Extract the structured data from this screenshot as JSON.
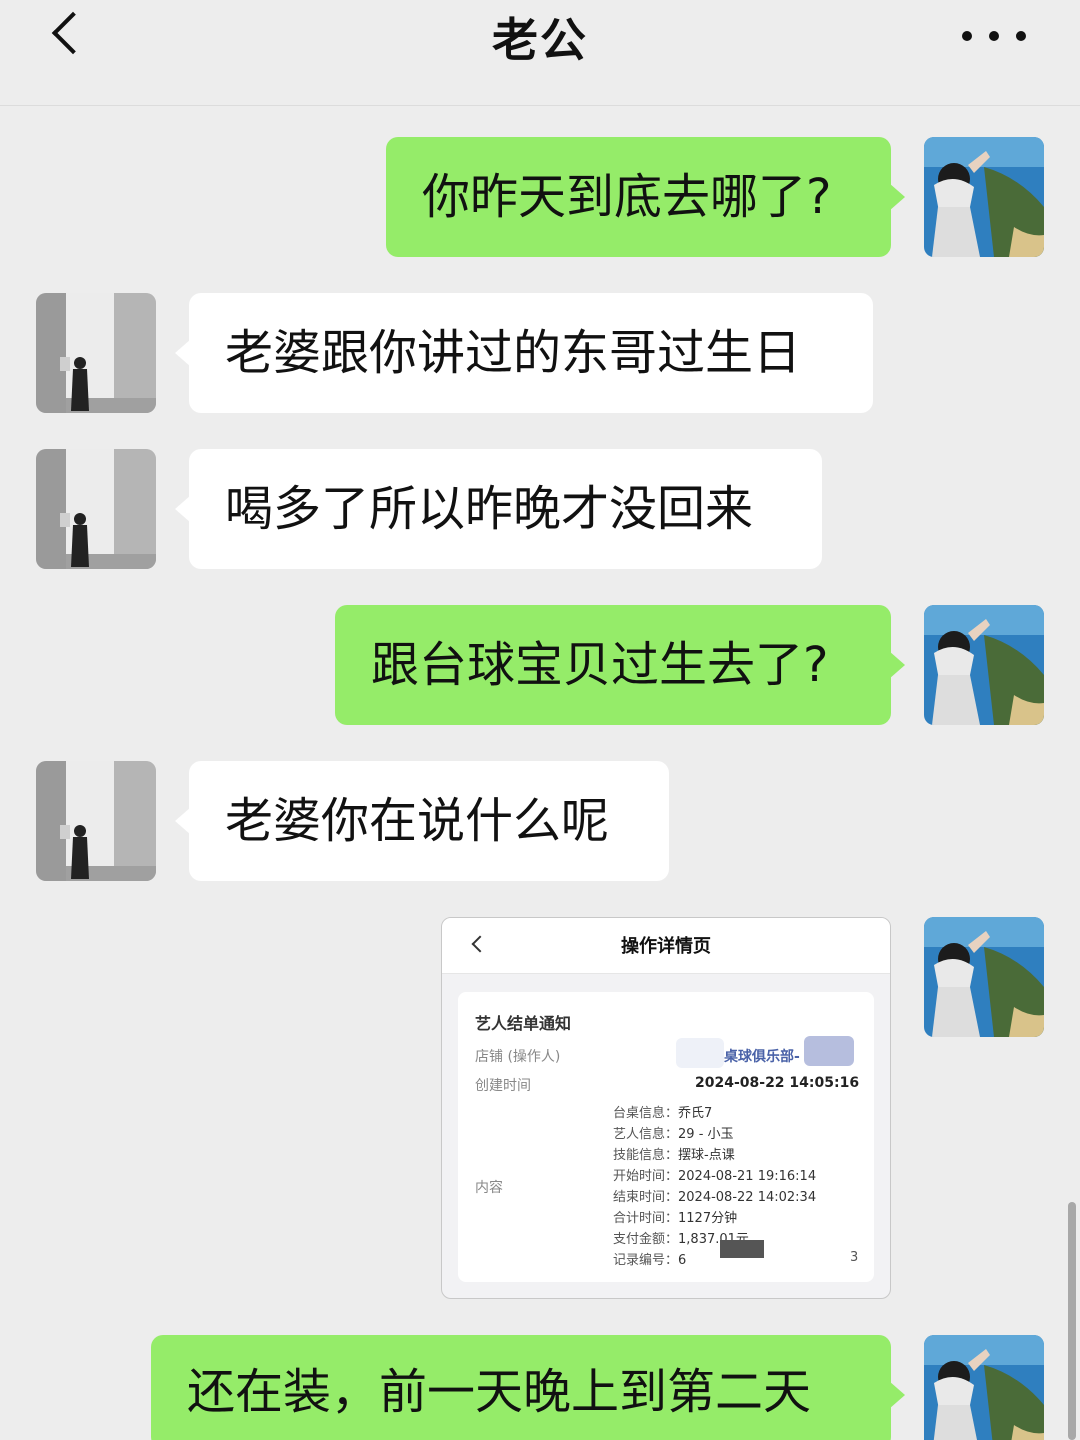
{
  "header": {
    "title": "老公"
  },
  "messages": [
    {
      "text": "你昨天到底去哪了?"
    },
    {
      "text": "老婆跟你讲过的东哥过生日"
    },
    {
      "text": "喝多了所以昨晚才没回来"
    },
    {
      "text": "跟台球宝贝过生去了?"
    },
    {
      "text": "老婆你在说什么呢"
    },
    {
      "text": "还在装，前一天晚上到第二天"
    }
  ],
  "screenshot": {
    "title": "操作详情页",
    "card_title": "艺人结单通知",
    "store_label": "店铺 (操作人)",
    "store_value": "桌球俱乐部-",
    "created_label": "创建时间",
    "created_value": "2024-08-22 14:05:16",
    "content_label": "内容",
    "details": [
      {
        "key": "台桌信息：",
        "value": "乔氏7"
      },
      {
        "key": "艺人信息：",
        "value": "29 - 小玉"
      },
      {
        "key": "技能信息：",
        "value": "摆球-点课"
      },
      {
        "key": "开始时间：",
        "value": "2024-08-21 19:16:14"
      },
      {
        "key": "结束时间：",
        "value": "2024-08-22 14:02:34"
      },
      {
        "key": "合计时间：",
        "value": "1127分钟"
      },
      {
        "key": "支付金额：",
        "value": "1,837.01元"
      },
      {
        "key": "记录编号：",
        "value": "6"
      }
    ],
    "record_tail": "3"
  },
  "theme": {
    "me_bubble": "#95ec69",
    "other_bubble": "#ffffff",
    "background": "#ededed",
    "link": "#4a62a8"
  }
}
